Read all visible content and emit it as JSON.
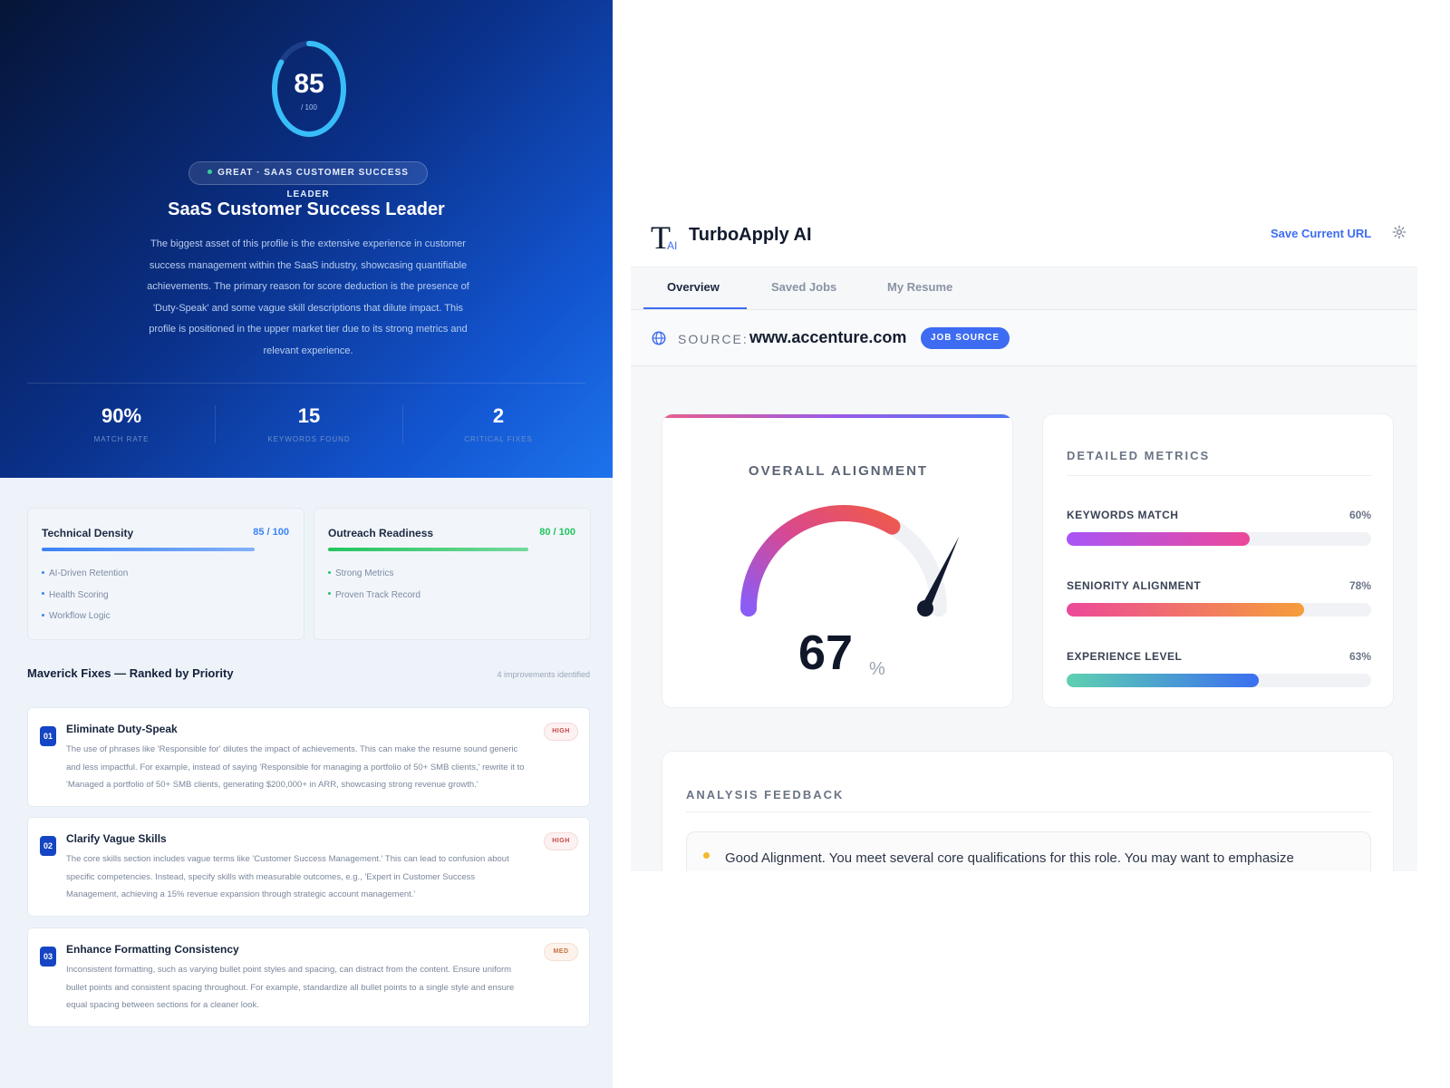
{
  "resume_report": {
    "score": {
      "value": "85",
      "max": "/ 100",
      "fraction": 0.85
    },
    "pill_label": "GREAT · SAAS CUSTOMER SUCCESS LEADER",
    "title": "SaaS Customer Success Leader",
    "description": "The biggest asset of this profile is the extensive experience in customer success management within the SaaS industry, showcasing quantifiable achievements. The primary reason for score deduction is the presence of 'Duty-Speak' and some vague skill descriptions that dilute impact. This profile is positioned in the upper market tier due to its strong metrics and relevant experience.",
    "stats": [
      {
        "value": "90%",
        "label": "MATCH RATE"
      },
      {
        "value": "15",
        "label": "KEYWORDS FOUND"
      },
      {
        "value": "2",
        "label": "CRITICAL FIXES"
      }
    ],
    "categories": [
      {
        "title": "Technical Density",
        "score": "85 / 100",
        "fraction": 0.85,
        "color": "#3b82f6",
        "bullets": [
          "AI-Driven Retention",
          "Health Scoring",
          "Workflow Logic"
        ]
      },
      {
        "title": "Outreach Readiness",
        "score": "80 / 100",
        "fraction": 0.8,
        "color": "#22c55e",
        "bullets": [
          "Strong Metrics",
          "Proven Track Record"
        ]
      }
    ],
    "fixes_title": "Maverick Fixes — Ranked by Priority",
    "fixes_count": "4 improvements identified",
    "fixes": [
      {
        "num": "01",
        "title": "Eliminate Duty-Speak",
        "priority": "HIGH",
        "description": "The use of phrases like 'Responsible for' dilutes the impact of achievements. This can make the resume sound generic and less impactful. For example, instead of saying 'Responsible for managing a portfolio of 50+ SMB clients,' rewrite it to 'Managed a portfolio of 50+ SMB clients, generating $200,000+ in ARR, showcasing strong revenue growth.'"
      },
      {
        "num": "02",
        "title": "Clarify Vague Skills",
        "priority": "HIGH",
        "description": "The core skills section includes vague terms like 'Customer Success Management.' This can lead to confusion about specific competencies. Instead, specify skills with measurable outcomes, e.g., 'Expert in Customer Success Management, achieving a 15% revenue expansion through strategic account management.'"
      },
      {
        "num": "03",
        "title": "Enhance Formatting Consistency",
        "priority": "MED",
        "description": "Inconsistent formatting, such as varying bullet point styles and spacing, can distract from the content. Ensure uniform bullet points and consistent spacing throughout. For example, standardize all bullet points to a single style and ensure equal spacing between sections for a cleaner look."
      }
    ]
  },
  "extension": {
    "app_title": "TurboApply AI",
    "logo_text": "T",
    "logo_sub": "AI",
    "save_url_label": "Save Current URL",
    "tabs": [
      "Overview",
      "Saved Jobs",
      "My Resume"
    ],
    "active_tab": 0,
    "source": {
      "label": "SOURCE:",
      "url": "www.accenture.com",
      "badge": "JOB SOURCE"
    },
    "alignment": {
      "title": "OVERALL ALIGNMENT",
      "value": "67",
      "unit": "%",
      "fraction": 0.67
    },
    "metrics_title": "DETAILED METRICS",
    "metrics": [
      {
        "label": "KEYWORDS MATCH",
        "value": "60%",
        "fraction": 0.6,
        "from": "#a855f7",
        "to": "#ec4899"
      },
      {
        "label": "SENIORITY ALIGNMENT",
        "value": "78%",
        "fraction": 0.78,
        "from": "#ec4899",
        "to": "#f59e3a"
      },
      {
        "label": "EXPERIENCE LEVEL",
        "value": "63%",
        "fraction": 0.63,
        "from": "#5ed1b0",
        "to": "#3b6ff0"
      }
    ],
    "feedback_title": "ANALYSIS FEEDBACK",
    "feedback_text": "Good Alignment. You meet several core qualifications for this role. You may want to emphasize"
  },
  "colors": {
    "accent": "#3d6cf2",
    "hero_dark": "#061537",
    "hero_light": "#1d73ec"
  }
}
